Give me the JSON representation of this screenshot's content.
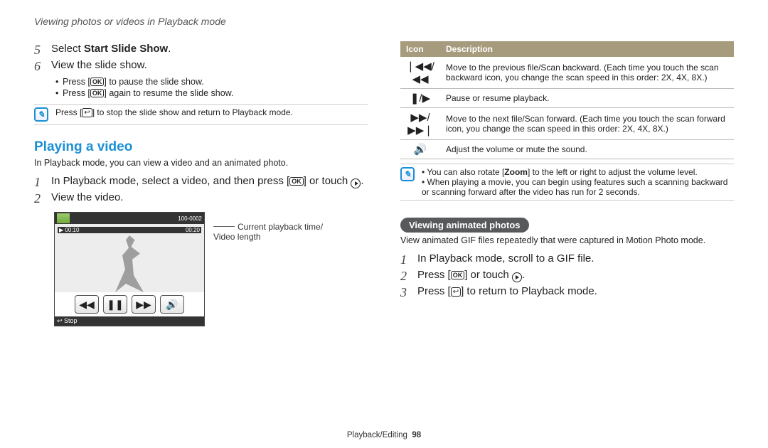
{
  "header": "Viewing photos or videos in Playback mode",
  "left": {
    "step5_num": "5",
    "step5_pre": "Select ",
    "step5_bold": "Start Slide Show",
    "step5_post": ".",
    "step6_num": "6",
    "step6_txt": "View the slide show.",
    "bullet1_a": "Press [",
    "bullet1_b": "] to pause the slide show.",
    "bullet2_a": "Press [",
    "bullet2_b": "] again to resume the slide show.",
    "note1_a": "Press [",
    "note1_b": "] to stop the slide show and return to Playback mode.",
    "section_title": "Playing a video",
    "section_sub": "In Playback mode, you can view a video and an animated photo.",
    "pv1_num": "1",
    "pv1_a": "In Playback mode, select a video, and then press [",
    "pv1_b": "] or touch ",
    "pv1_c": ".",
    "pv2_num": "2",
    "pv2_txt": "View the video.",
    "cam_top_right": "100-0002",
    "cam_time_left": "00:10",
    "cam_time_right": "00:20",
    "cam_stop": "Stop",
    "cap1": "Current playback time/",
    "cap2": "Video length"
  },
  "right": {
    "th_icon": "Icon",
    "th_desc": "Description",
    "row1_icon": "❘◀◀/◀◀",
    "row1_desc": "Move to the previous file/Scan backward. (Each time you touch the scan backward icon, you change the scan speed in this order: 2X, 4X, 8X.)",
    "row2_icon": "❚/▶",
    "row2_desc": "Pause or resume playback.",
    "row3_icon": "▶▶/▶▶❘",
    "row3_desc": "Move to the next file/Scan forward. (Each time you touch the scan forward icon, you change the scan speed in this order: 2X, 4X, 8X.)",
    "row4_icon": "🔊",
    "row4_desc": "Adjust the volume or mute the sound.",
    "note2a_a": "You can also rotate [",
    "note2a_bold": "Zoom",
    "note2a_b": "] to the left or right to adjust the volume level.",
    "note2b": "When playing a movie, you can begin using features such a scanning backward or scanning forward after the video has run for 2 seconds.",
    "pill": "Viewing animated photos",
    "pill_sub": "View animated GIF files repeatedly that were captured in Motion Photo mode.",
    "g1_num": "1",
    "g1_txt": "In Playback mode, scroll to a GIF file.",
    "g2_num": "2",
    "g2_a": "Press [",
    "g2_b": "] or touch ",
    "g2_c": ".",
    "g3_num": "3",
    "g3_a": "Press [",
    "g3_b": "] to return to Playback mode."
  },
  "footer": {
    "label": "Playback/Editing",
    "page": "98"
  },
  "glyph": {
    "ok": "OK",
    "back": "↩"
  }
}
